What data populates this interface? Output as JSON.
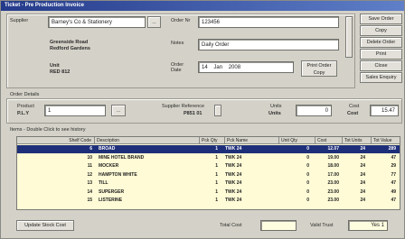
{
  "window": {
    "title": "Ticket - Pre Production Invoice"
  },
  "supplier": {
    "label": "Supplier",
    "value": "Barney's Co & Stationery",
    "address": [
      "Greenside Road",
      "Redford Gardens"
    ],
    "label_area": "Unit",
    "area": "RED 812"
  },
  "invoice": {
    "order_label": "Order Nr",
    "order_value": "123456",
    "notes_label": "Notes",
    "notes_value": "Daily Order",
    "date_label": "Order Date",
    "date_day": "14",
    "date_month": "Jan",
    "date_year": "2008",
    "print_label": "Print Order",
    "print_label2": "Copy"
  },
  "side_buttons": [
    "Save Order",
    "Copy",
    "Delete Order",
    "Print",
    "Close",
    "Sales Enquiry"
  ],
  "order_header": {
    "section_label": "Order Details",
    "product_label": "Product",
    "product_sub": "P.L.Y",
    "product_code": "1",
    "supplier_ref_label": "Supplier Reference",
    "supplier_ref_value": "P851 01",
    "unit_label": "Units",
    "unit_sub": "Units",
    "unit_value": "0",
    "cost_label": "Cost",
    "cost_sub": "Cost",
    "cost_value": "15.47"
  },
  "grid": {
    "caption": "Items - Double Click to see history",
    "columns": [
      "Shelf Code",
      "Description",
      "Pck Qty",
      "Pck Name",
      "Unit Qty",
      "Cost",
      "Tot Units",
      "Tot Value"
    ],
    "rows": [
      {
        "code": "6",
        "desc": "BROAD",
        "pq": "1",
        "pn": "TWK 24",
        "uq": "0",
        "cost": "12.07",
        "tu": "24",
        "tv": "289"
      },
      {
        "code": "10",
        "desc": "MINE HOTEL BRAND",
        "pq": "1",
        "pn": "TWK 24",
        "uq": "0",
        "cost": "19.00",
        "tu": "24",
        "tv": "47"
      },
      {
        "code": "11",
        "desc": "MOCKER",
        "pq": "1",
        "pn": "TWK 24",
        "uq": "0",
        "cost": "18.00",
        "tu": "24",
        "tv": "29"
      },
      {
        "code": "12",
        "desc": "HAMPTON WHITE",
        "pq": "1",
        "pn": "TWK 24",
        "uq": "0",
        "cost": "17.00",
        "tu": "24",
        "tv": "77"
      },
      {
        "code": "13",
        "desc": "TILL",
        "pq": "1",
        "pn": "TWK 24",
        "uq": "0",
        "cost": "23.00",
        "tu": "24",
        "tv": "47"
      },
      {
        "code": "14",
        "desc": "SUPERGER",
        "pq": "1",
        "pn": "TWK 24",
        "uq": "0",
        "cost": "23.00",
        "tu": "24",
        "tv": "49"
      },
      {
        "code": "15",
        "desc": "LISTERINE",
        "pq": "1",
        "pn": "TWK 24",
        "uq": "0",
        "cost": "23.00",
        "tu": "24",
        "tv": "47"
      }
    ]
  },
  "footer": {
    "add_label": "Update Stock Cost",
    "total_label": "Total Cost",
    "total_value": "",
    "valid_label": "Valid Trust",
    "valid_value": "Yes 1"
  }
}
